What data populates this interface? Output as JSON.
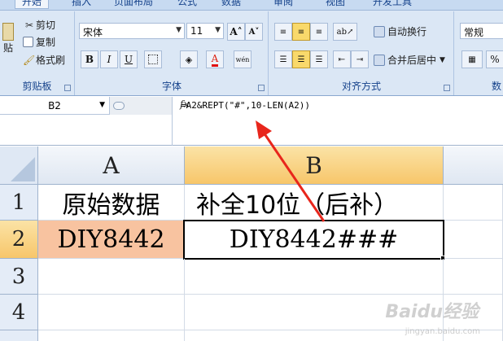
{
  "ribbon": {
    "tabs": [
      "开始",
      "插入",
      "页面布局",
      "公式",
      "数据",
      "审阅",
      "视图",
      "开发工具"
    ],
    "clipboard": {
      "cut": "剪切",
      "copy": "复制",
      "format_painter": "格式刷",
      "paste_partial": "贴",
      "label": "剪贴板"
    },
    "font": {
      "name": "宋体",
      "size": "11",
      "bold": "B",
      "italic": "I",
      "underline": "U",
      "color_letter": "A",
      "phonetic": "wén",
      "label": "字体"
    },
    "alignment": {
      "wrap_text": "自动换行",
      "merge_center": "合并后居中",
      "label": "对齐方式"
    },
    "number": {
      "format": "常规",
      "percent": "%",
      "label_partial": "数"
    }
  },
  "formula_bar": {
    "name_box": "B2",
    "fx": "fx",
    "formula": "=A2&REPT(\"#\",10-LEN(A2))"
  },
  "grid": {
    "columns": [
      "A",
      "B"
    ],
    "rows": [
      "1",
      "2",
      "3",
      "4"
    ],
    "cells": {
      "A1": "原始数据",
      "B1": "补全10位（后补）",
      "A2": "DIY8442",
      "B2": "DIY8442###"
    }
  },
  "colors": {
    "selected_header": "#f7c66a",
    "a2_fill": "#f8c3a0",
    "arrow": "#e8261c"
  },
  "watermark": {
    "text": "Baidu经验",
    "sub": "jingyan.baidu.com"
  }
}
